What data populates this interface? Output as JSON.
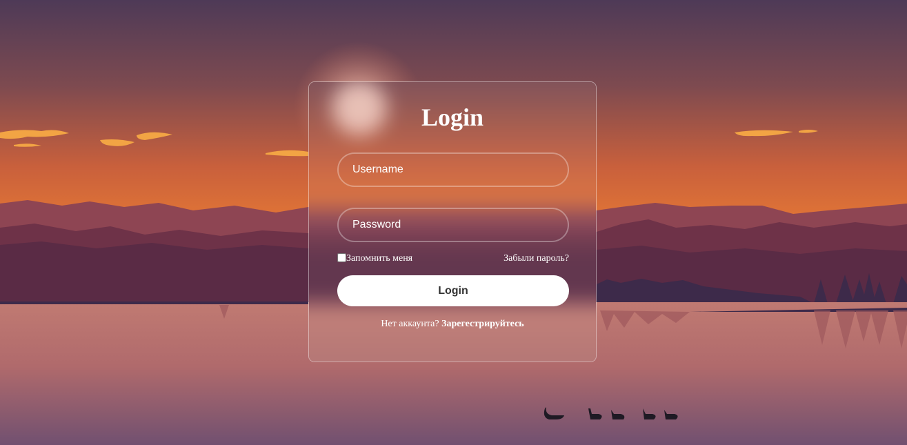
{
  "login": {
    "title": "Login",
    "username_placeholder": "Username",
    "password_placeholder": "Password",
    "remember_label": "Запомнить меня",
    "forgot_label": "Забыли пароль?",
    "submit_label": "Login",
    "no_account_text": "Нет аккаунта?",
    "register_label": "Зарегестрируйтесь"
  },
  "colors": {
    "sky_top": "#4e3a57",
    "sky_glow": "#e07436",
    "mountains_far": "#8a4150",
    "mountains_near": "#5a2b45",
    "lake": "#c47a70",
    "lake_bottom": "#715070",
    "button_bg": "#ffffff",
    "button_text": "#333333"
  }
}
